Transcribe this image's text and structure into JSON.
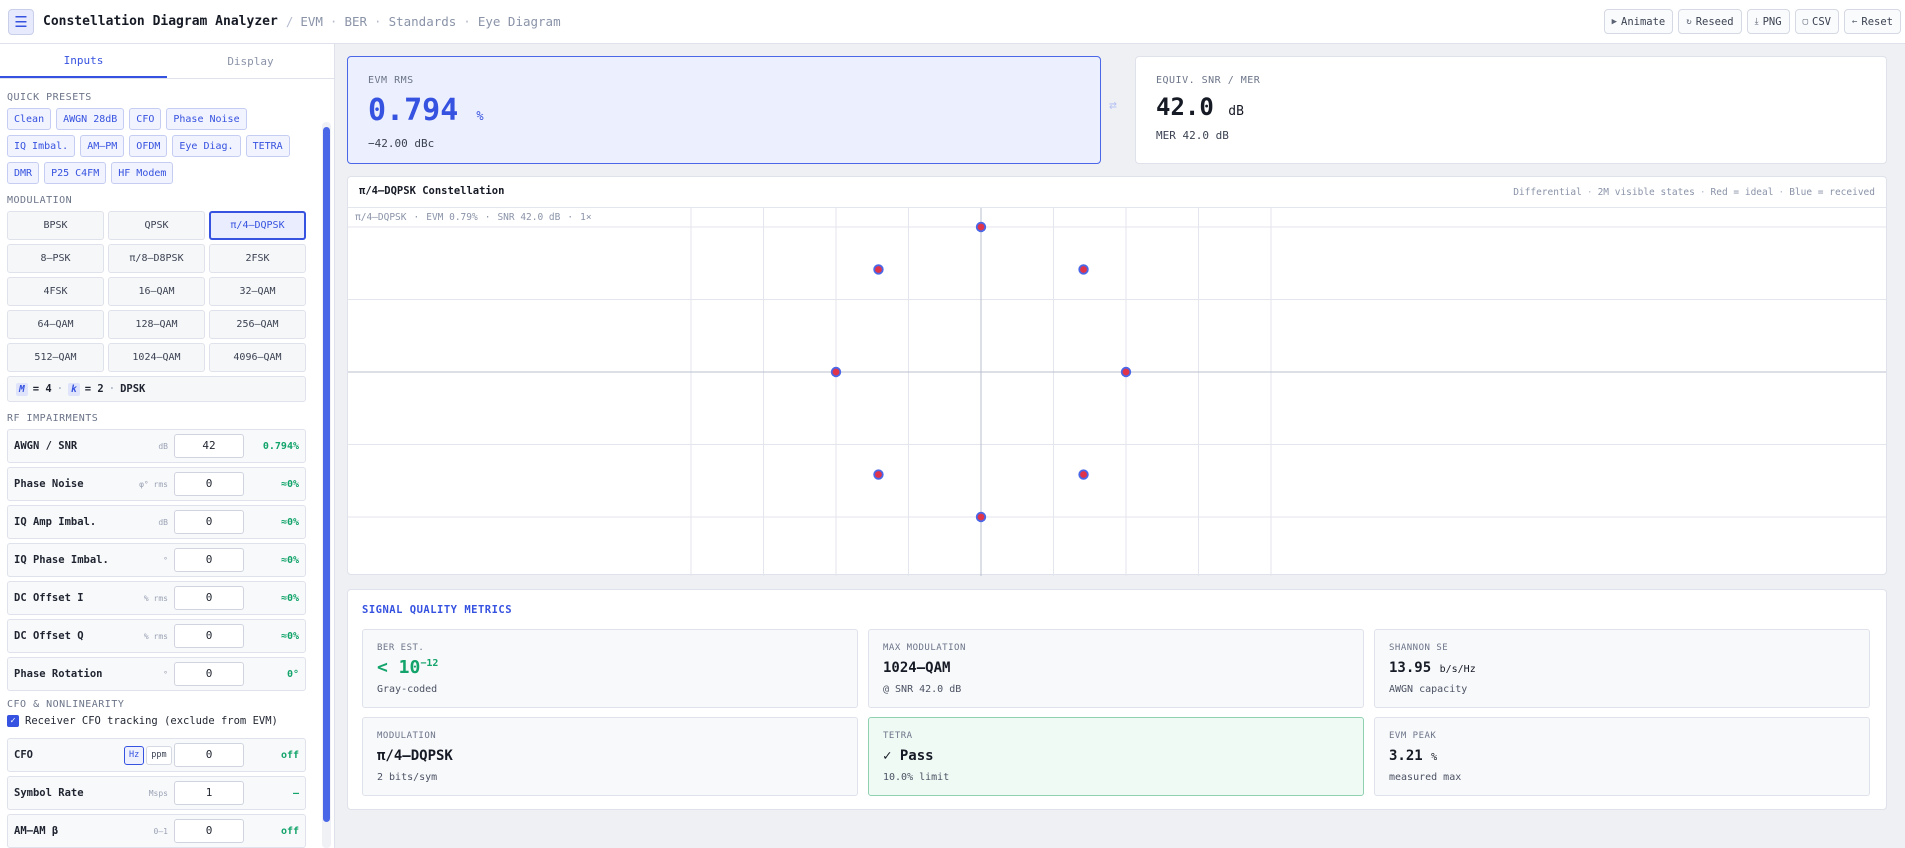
{
  "header": {
    "title": "Constellation Diagram Analyzer",
    "crumbs": [
      "EVM",
      "BER",
      "Standards",
      "Eye Diagram"
    ],
    "actions": [
      {
        "label": "Animate",
        "icon": "play-icon"
      },
      {
        "label": "Reseed",
        "icon": "refresh-icon"
      },
      {
        "label": "PNG",
        "icon": "download-icon"
      },
      {
        "label": "CSV",
        "icon": "file-icon"
      },
      {
        "label": "Reset",
        "icon": "arrow-left-icon"
      }
    ]
  },
  "sidebar": {
    "tabs": [
      "Inputs",
      "Display"
    ],
    "presets_title": "QUICK PRESETS",
    "presets": [
      "Clean",
      "AWGN 28dB",
      "CFO",
      "Phase Noise",
      "IQ Imbal.",
      "AM–PM",
      "OFDM",
      "Eye Diag.",
      "TETRA",
      "DMR",
      "P25 C4FM",
      "HF Modem"
    ],
    "modulation_title": "MODULATION",
    "modulations": [
      "BPSK",
      "QPSK",
      "π/4–DQPSK",
      "8–PSK",
      "π/8–D8PSK",
      "2FSK",
      "4FSK",
      "16–QAM",
      "32–QAM",
      "64–QAM",
      "128–QAM",
      "256–QAM",
      "512–QAM",
      "1024–QAM",
      "4096–QAM"
    ],
    "selected_modulation": "π/4–DQPSK",
    "mk": {
      "m_tag": "M",
      "m_val": "= 4",
      "k_tag": "k",
      "k_val": "= 2",
      "kind": "DPSK"
    },
    "rf_title": "RF IMPAIRMENTS",
    "impairments": [
      {
        "label": "AWGN / SNR",
        "unit": "dB",
        "value": "42",
        "result": "0.794%"
      },
      {
        "label": "Phase Noise",
        "unit": "φ° rms",
        "value": "0",
        "result": "≈0%"
      },
      {
        "label": "IQ Amp Imbal.",
        "unit": "dB",
        "value": "0",
        "result": "≈0%"
      },
      {
        "label": "IQ Phase Imbal.",
        "unit": "°",
        "value": "0",
        "result": "≈0%"
      },
      {
        "label": "DC Offset I",
        "unit": "% rms",
        "value": "0",
        "result": "≈0%"
      },
      {
        "label": "DC Offset Q",
        "unit": "% rms",
        "value": "0",
        "result": "≈0%"
      },
      {
        "label": "Phase Rotation",
        "unit": "°",
        "value": "0",
        "result": "0°"
      }
    ],
    "cfo_title": "CFO & NONLINEARITY",
    "cfo_check_label": "Receiver CFO tracking (exclude from EVM)",
    "cfo_rows": [
      {
        "label": "CFO",
        "units": [
          "Hz",
          "ppm"
        ],
        "value": "0",
        "result": "off"
      },
      {
        "label": "Symbol Rate",
        "unit": "Msps",
        "value": "1",
        "result": "—"
      },
      {
        "label": "AM–AM β",
        "unit": "0–1",
        "value": "0",
        "result": "off"
      }
    ]
  },
  "evm": {
    "label": "EVM RMS",
    "value": "0.794",
    "unit": "%",
    "sub": "−42.00 dBc"
  },
  "snr": {
    "label": "EQUIV. SNR / MER",
    "value": "42.0",
    "unit": "dB",
    "sub": "MER 42.0 dB"
  },
  "constellation": {
    "title": "π/4–DQPSK Constellation",
    "meta": [
      "Differential",
      "2M visible states",
      "Red = ideal",
      "Blue = received"
    ],
    "info": [
      "π/4–DQPSK",
      "EVM 0.79%",
      "SNR 42.0 dB",
      "1×"
    ]
  },
  "chart_data": {
    "type": "scatter",
    "title": "π/4–DQPSK Constellation",
    "series": [
      {
        "name": "ideal",
        "color": "#e0344a",
        "points": [
          [
            0,
            1
          ],
          [
            0.7071,
            0.7071
          ],
          [
            1,
            0
          ],
          [
            0.7071,
            -0.7071
          ],
          [
            0,
            -1
          ],
          [
            -0.7071,
            -0.7071
          ],
          [
            -1,
            0
          ],
          [
            -0.7071,
            0.7071
          ]
        ]
      },
      {
        "name": "received",
        "color": "#4a67e8",
        "points": [
          [
            0,
            1
          ],
          [
            0.7071,
            0.7071
          ],
          [
            1,
            0
          ],
          [
            0.7071,
            -0.7071
          ],
          [
            0,
            -1
          ],
          [
            -0.7071,
            -0.7071
          ],
          [
            -1,
            0
          ],
          [
            -0.7071,
            0.7071
          ]
        ]
      }
    ]
  },
  "metrics": {
    "title": "SIGNAL QUALITY METRICS",
    "ber": {
      "label": "BER EST.",
      "value": "< 10",
      "exp": "−12",
      "sub": "Gray-coded"
    },
    "maxmod": {
      "label": "MAX MODULATION",
      "value": "1024–QAM",
      "sub": "@ SNR 42.0 dB"
    },
    "shannon": {
      "label": "SHANNON SE",
      "value": "13.95",
      "unit": "b/s/Hz",
      "sub": "AWGN capacity"
    },
    "modulation": {
      "label": "MODULATION",
      "value": "π/4–DQPSK",
      "sub": "2 bits/sym"
    },
    "tetra": {
      "label": "TETRA",
      "value": "✓ Pass",
      "sub": "10.0% limit"
    },
    "evm_peak": {
      "label": "EVM PEAK",
      "value": "3.21",
      "unit": "%",
      "sub": "measured max"
    }
  }
}
